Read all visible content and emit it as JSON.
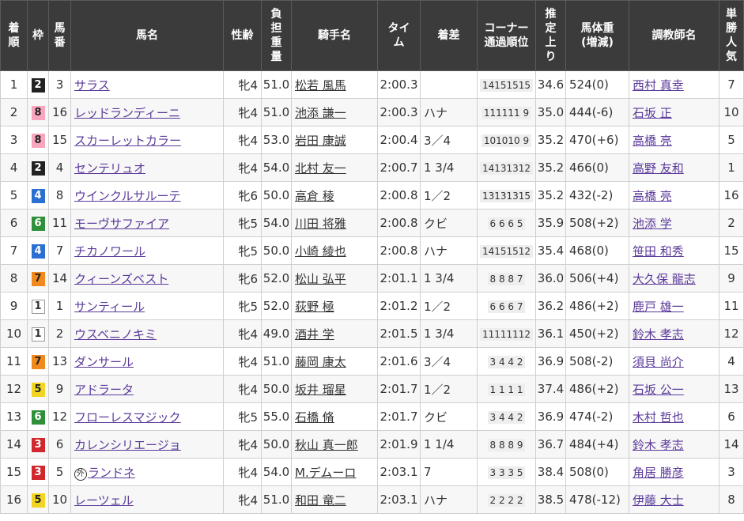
{
  "headers": {
    "rank": "着順",
    "waku": "枠",
    "num": "馬番",
    "horse": "馬名",
    "sexage": "性齢",
    "weight_carried": "負担重量",
    "jockey": "騎手名",
    "time": "タイム",
    "margin": "着差",
    "corner": "コーナー通過順位",
    "last3f": "推定上り",
    "body_weight": "馬体重(増減)",
    "trainer": "調教師名",
    "popularity": "単勝人気"
  },
  "colors": {
    "header_bg": "#3b3b3b",
    "link": "#5b3a9a",
    "waku1": "#ffffff",
    "waku2": "#222222",
    "waku3": "#d0282e",
    "waku4": "#2a6fd1",
    "waku5": "#f2d522",
    "waku6": "#2f8f3a",
    "waku7": "#f08a1d",
    "waku8": "#f7a6bd"
  },
  "rows": [
    {
      "rank": "1",
      "waku": "2",
      "num": "3",
      "horse": "サラス",
      "foreign": "",
      "sexage": "牝4",
      "weight": "51.0",
      "jockey": "松若 風馬",
      "time": "2:00.3",
      "margin": "",
      "corner": "14151515",
      "last3f": "34.6",
      "body": "524(0)",
      "trainer": "西村 真幸",
      "pop": "7"
    },
    {
      "rank": "2",
      "waku": "8",
      "num": "16",
      "horse": "レッドランディーニ",
      "foreign": "",
      "sexage": "牝4",
      "weight": "51.0",
      "jockey": "池添 謙一",
      "time": "2:00.3",
      "margin": "ハナ",
      "corner": "111111 9",
      "last3f": "35.0",
      "body": "444(-6)",
      "trainer": "石坂 正",
      "pop": "10"
    },
    {
      "rank": "3",
      "waku": "8",
      "num": "15",
      "horse": "スカーレットカラー",
      "foreign": "",
      "sexage": "牝4",
      "weight": "53.0",
      "jockey": "岩田 康誠",
      "time": "2:00.4",
      "margin": "3／4",
      "corner": "101010 9",
      "last3f": "35.2",
      "body": "470(+6)",
      "trainer": "高橋 亮",
      "pop": "5"
    },
    {
      "rank": "4",
      "waku": "2",
      "num": "4",
      "horse": "センテリュオ",
      "foreign": "",
      "sexage": "牝4",
      "weight": "54.0",
      "jockey": "北村 友一",
      "time": "2:00.7",
      "margin": "1 3/4",
      "corner": "14131312",
      "last3f": "35.2",
      "body": "466(0)",
      "trainer": "高野 友和",
      "pop": "1"
    },
    {
      "rank": "5",
      "waku": "4",
      "num": "8",
      "horse": "ウインクルサルーテ",
      "foreign": "",
      "sexage": "牝6",
      "weight": "50.0",
      "jockey": "高倉 稜",
      "time": "2:00.8",
      "margin": "1／2",
      "corner": "13131315",
      "last3f": "35.2",
      "body": "432(-2)",
      "trainer": "高橋 亮",
      "pop": "16"
    },
    {
      "rank": "6",
      "waku": "6",
      "num": "11",
      "horse": "モーヴサファイア",
      "foreign": "",
      "sexage": "牝5",
      "weight": "54.0",
      "jockey": "川田 将雅",
      "time": "2:00.8",
      "margin": "クビ",
      "corner": "6 6 6 5",
      "last3f": "35.9",
      "body": "508(+2)",
      "trainer": "池添 学",
      "pop": "2"
    },
    {
      "rank": "7",
      "waku": "4",
      "num": "7",
      "horse": "チカノワール",
      "foreign": "",
      "sexage": "牝5",
      "weight": "50.0",
      "jockey": "小崎 綾也",
      "time": "2:00.8",
      "margin": "ハナ",
      "corner": "14151512",
      "last3f": "35.4",
      "body": "468(0)",
      "trainer": "笹田 和秀",
      "pop": "15"
    },
    {
      "rank": "8",
      "waku": "7",
      "num": "14",
      "horse": "クィーンズベスト",
      "foreign": "",
      "sexage": "牝6",
      "weight": "52.0",
      "jockey": "松山 弘平",
      "time": "2:01.1",
      "margin": "1 3/4",
      "corner": "8 8 8 7",
      "last3f": "36.0",
      "body": "506(+4)",
      "trainer": "大久保 龍志",
      "pop": "9"
    },
    {
      "rank": "9",
      "waku": "1",
      "num": "1",
      "horse": "サンティール",
      "foreign": "",
      "sexage": "牝5",
      "weight": "52.0",
      "jockey": "荻野 極",
      "time": "2:01.2",
      "margin": "1／2",
      "corner": "6 6 6 7",
      "last3f": "36.2",
      "body": "486(+2)",
      "trainer": "鹿戸 雄一",
      "pop": "11"
    },
    {
      "rank": "10",
      "waku": "1",
      "num": "2",
      "horse": "ウスベニノキミ",
      "foreign": "",
      "sexage": "牝4",
      "weight": "49.0",
      "jockey": "酒井 学",
      "time": "2:01.5",
      "margin": "1 3/4",
      "corner": "11111112",
      "last3f": "36.1",
      "body": "450(+2)",
      "trainer": "鈴木 孝志",
      "pop": "12"
    },
    {
      "rank": "11",
      "waku": "7",
      "num": "13",
      "horse": "ダンサール",
      "foreign": "",
      "sexage": "牝4",
      "weight": "51.0",
      "jockey": "藤岡 康太",
      "time": "2:01.6",
      "margin": "3／4",
      "corner": "3 4 4 2",
      "last3f": "36.9",
      "body": "508(-2)",
      "trainer": "須貝 尚介",
      "pop": "4"
    },
    {
      "rank": "12",
      "waku": "5",
      "num": "9",
      "horse": "アドラータ",
      "foreign": "",
      "sexage": "牝4",
      "weight": "50.0",
      "jockey": "坂井 瑠星",
      "time": "2:01.7",
      "margin": "1／2",
      "corner": "1 1 1 1",
      "last3f": "37.4",
      "body": "486(+2)",
      "trainer": "石坂 公一",
      "pop": "13"
    },
    {
      "rank": "13",
      "waku": "6",
      "num": "12",
      "horse": "フローレスマジック",
      "foreign": "",
      "sexage": "牝5",
      "weight": "55.0",
      "jockey": "石橋 脩",
      "time": "2:01.7",
      "margin": "クビ",
      "corner": "3 4 4 2",
      "last3f": "36.9",
      "body": "474(-2)",
      "trainer": "木村 哲也",
      "pop": "6"
    },
    {
      "rank": "14",
      "waku": "3",
      "num": "6",
      "horse": "カレンシリエージョ",
      "foreign": "",
      "sexage": "牝4",
      "weight": "50.0",
      "jockey": "秋山 真一郎",
      "time": "2:01.9",
      "margin": "1 1/4",
      "corner": "8 8 8 9",
      "last3f": "36.7",
      "body": "484(+4)",
      "trainer": "鈴木 孝志",
      "pop": "14"
    },
    {
      "rank": "15",
      "waku": "3",
      "num": "5",
      "horse": "ランドネ",
      "foreign": "外",
      "sexage": "牝4",
      "weight": "54.0",
      "jockey": "M.デムーロ",
      "time": "2:03.1",
      "margin": "7",
      "corner": "3 3 3 5",
      "last3f": "38.4",
      "body": "508(0)",
      "trainer": "角居 勝彦",
      "pop": "3"
    },
    {
      "rank": "16",
      "waku": "5",
      "num": "10",
      "horse": "レーツェル",
      "foreign": "",
      "sexage": "牝4",
      "weight": "51.0",
      "jockey": "和田 竜二",
      "time": "2:03.1",
      "margin": "ハナ",
      "corner": "2 2 2 2",
      "last3f": "38.5",
      "body": "478(-12)",
      "trainer": "伊藤 大士",
      "pop": "8"
    }
  ]
}
